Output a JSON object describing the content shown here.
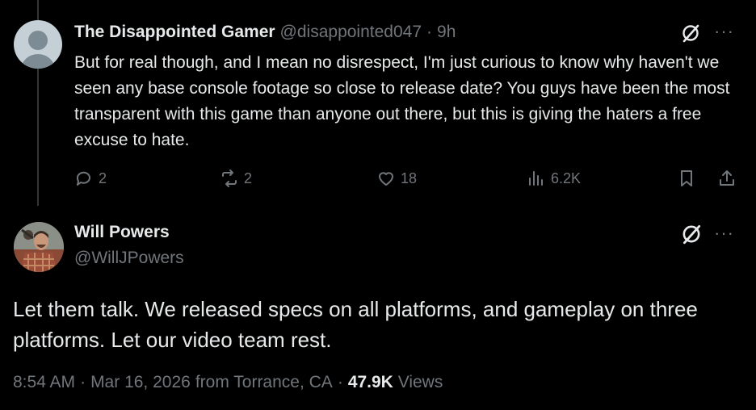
{
  "reply": {
    "name": "The Disappointed Gamer",
    "handle": "@disappointed047",
    "separator": "·",
    "time": "9h",
    "text": "But for real though, and I mean no disrespect, I'm just curious to know why haven't we seen any base console footage so close to release date? You guys have been the most transparent with this game than anyone out there, but this is giving the haters a free excuse to hate.",
    "more": "···",
    "actions": {
      "replies": "2",
      "reposts": "2",
      "likes": "18",
      "views": "6.2K"
    }
  },
  "main": {
    "name": "Will Powers",
    "handle": "@WillJPowers",
    "more": "···",
    "text": "Let them talk. We released specs on all platforms, and gameplay on three platforms. Let our video team rest.",
    "meta": {
      "time": "8:54 AM",
      "sep1": "·",
      "date": "Mar 16, 2026",
      "location": "from Torrance, CA",
      "sep2": "·",
      "views_count": "47.9K",
      "views_label": "Views"
    }
  },
  "colors": {
    "background": "#000000",
    "text": "#e7e9ea",
    "muted": "#71767b"
  },
  "icons": [
    "default-avatar-icon",
    "grok-badge-icon",
    "more-icon",
    "reply-icon",
    "repost-icon",
    "like-icon",
    "views-icon",
    "bookmark-icon",
    "share-icon"
  ]
}
